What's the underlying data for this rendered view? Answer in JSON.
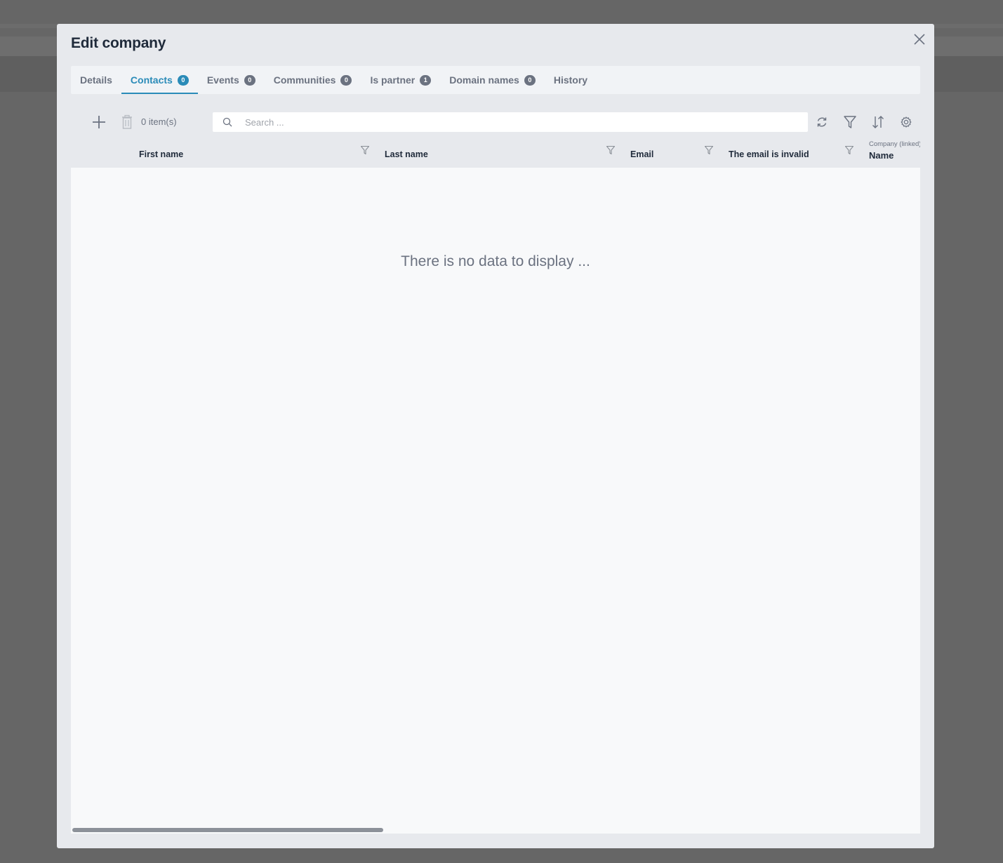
{
  "dialog": {
    "title": "Edit company"
  },
  "tabs": [
    {
      "label": "Details",
      "badge": null,
      "active": false
    },
    {
      "label": "Contacts",
      "badge": "0",
      "active": true
    },
    {
      "label": "Events",
      "badge": "0",
      "active": false
    },
    {
      "label": "Communities",
      "badge": "0",
      "active": false
    },
    {
      "label": "Is partner",
      "badge": "1",
      "active": false
    },
    {
      "label": "Domain names",
      "badge": "0",
      "active": false
    },
    {
      "label": "History",
      "badge": null,
      "active": false
    }
  ],
  "toolbar": {
    "item_count": "0 item(s)",
    "search_placeholder": "Search ..."
  },
  "columns": {
    "first_name": "First name",
    "last_name": "Last name",
    "email": "Email",
    "email_invalid": "The email is invalid",
    "company_group": "Company (linked)",
    "company_name": "Name"
  },
  "grid": {
    "empty_message": "There is no data to display ..."
  },
  "colors": {
    "accent": "#2a8bb8",
    "text": "#1f2a3a",
    "muted": "#6b7280"
  },
  "icons": [
    "close-icon",
    "plus-icon",
    "trash-icon",
    "search-icon",
    "refresh-icon",
    "filter-icon",
    "sort-icon",
    "gear-icon"
  ]
}
